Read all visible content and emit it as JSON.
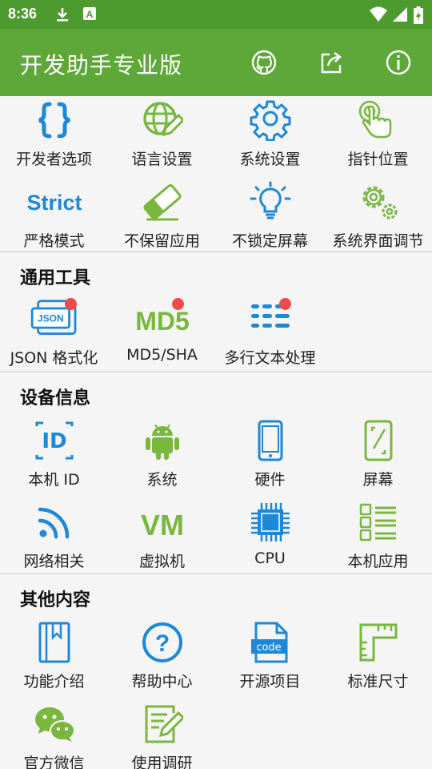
{
  "status_bar": {
    "time": "8:36",
    "icons": [
      "download-icon",
      "font-icon",
      "wifi-icon",
      "signal-icon",
      "battery-icon"
    ]
  },
  "app_bar": {
    "title": "开发助手专业版",
    "actions": [
      "github-icon",
      "share-icon",
      "info-icon"
    ]
  },
  "colors": {
    "app_bar": "#5da839",
    "status_bar": "#4d9b2e",
    "icon_blue": "#1e88d8",
    "icon_green": "#79b73f",
    "badge": "#f04a4a"
  },
  "quick_settings": {
    "items": [
      {
        "label": "开发者选项",
        "icon": "braces-icon"
      },
      {
        "label": "语言设置",
        "icon": "globe-pencil-icon"
      },
      {
        "label": "系统设置",
        "icon": "gear-icon"
      },
      {
        "label": "指针位置",
        "icon": "pointer-touch-icon"
      },
      {
        "label": "严格模式",
        "icon": "strict-icon",
        "icon_text": "Strict"
      },
      {
        "label": "不保留应用",
        "icon": "eraser-icon"
      },
      {
        "label": "不锁定屏幕",
        "icon": "bulb-icon"
      },
      {
        "label": "系统界面调节",
        "icon": "gears-icon"
      }
    ]
  },
  "tools": {
    "title": "通用工具",
    "items": [
      {
        "label": "JSON 格式化",
        "icon": "json-icon",
        "icon_text": "JSON",
        "badge": true
      },
      {
        "label": "MD5/SHA",
        "icon": "md5-icon",
        "icon_text": "MD5",
        "badge": true
      },
      {
        "label": "多行文本处理",
        "icon": "multiline-text-icon",
        "badge": true
      }
    ]
  },
  "device_info": {
    "title": "设备信息",
    "items": [
      {
        "label": "本机 ID",
        "icon": "id-icon",
        "icon_text": "ID"
      },
      {
        "label": "系统",
        "icon": "android-icon"
      },
      {
        "label": "硬件",
        "icon": "phone-icon"
      },
      {
        "label": "屏幕",
        "icon": "screen-icon"
      },
      {
        "label": "网络相关",
        "icon": "rss-icon"
      },
      {
        "label": "虚拟机",
        "icon": "vm-icon",
        "icon_text": "VM"
      },
      {
        "label": "CPU",
        "icon": "cpu-icon"
      },
      {
        "label": "本机应用",
        "icon": "app-list-icon"
      }
    ]
  },
  "other": {
    "title": "其他内容",
    "items": [
      {
        "label": "功能介绍",
        "icon": "book-icon"
      },
      {
        "label": "帮助中心",
        "icon": "help-icon",
        "icon_text": "?"
      },
      {
        "label": "开源项目",
        "icon": "code-file-icon",
        "icon_text": "code"
      },
      {
        "label": "标准尺寸",
        "icon": "ruler-icon"
      },
      {
        "label": "官方微信",
        "icon": "wechat-icon"
      },
      {
        "label": "使用调研",
        "icon": "survey-icon"
      }
    ]
  }
}
